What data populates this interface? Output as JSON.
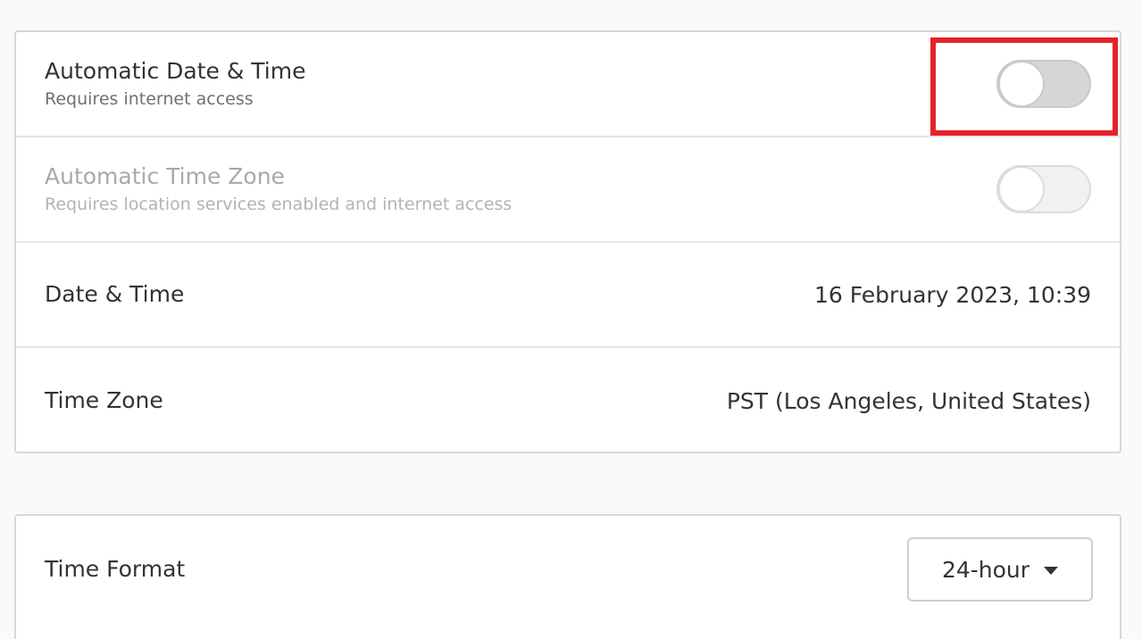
{
  "settings": {
    "automatic_date_time": {
      "title": "Automatic Date & Time",
      "subtitle": "Requires internet access",
      "enabled": false
    },
    "automatic_time_zone": {
      "title": "Automatic Time Zone",
      "subtitle": "Requires location services enabled and internet access",
      "enabled": false,
      "sensitive": false
    },
    "date_time": {
      "title": "Date & Time",
      "value": "16 February 2023, 10:39"
    },
    "time_zone": {
      "title": "Time Zone",
      "value": "PST (Los Angeles, United States)"
    },
    "time_format": {
      "title": "Time Format",
      "selected": "24-hour",
      "icon": "chevron-down-icon"
    }
  },
  "colors": {
    "highlight": "#e3232c",
    "switch_off": "#d6d6d6"
  }
}
